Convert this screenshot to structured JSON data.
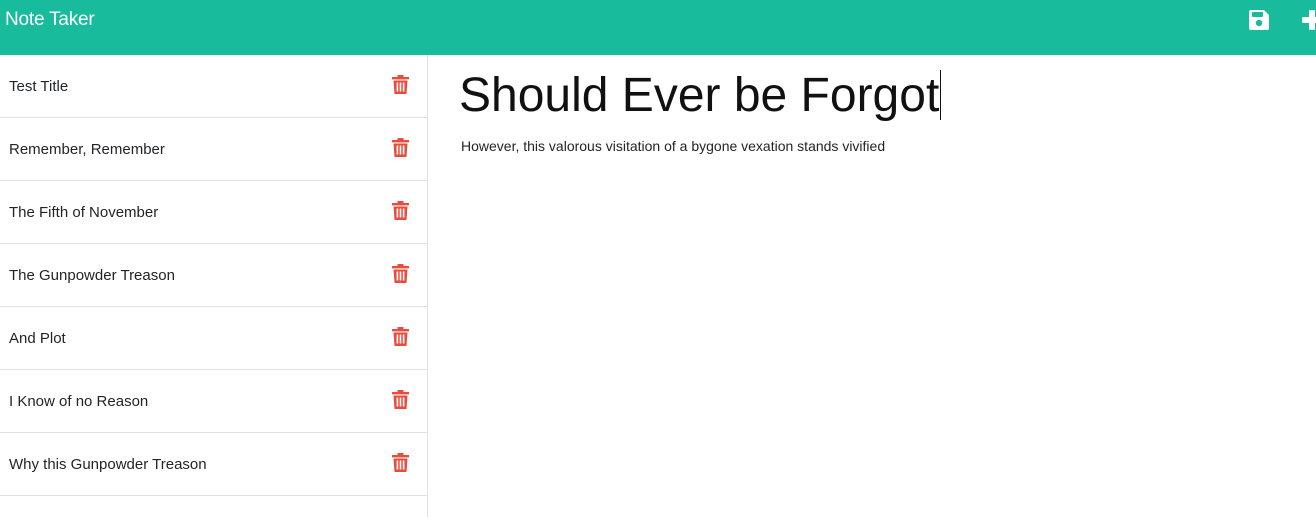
{
  "app": {
    "brand": "Note Taker",
    "accent_color": "#18bc9c",
    "delete_color": "#e74c3c"
  },
  "navbar": {
    "save_icon": "save-icon",
    "new_icon": "plus-icon"
  },
  "notes": [
    {
      "title": "Test Title"
    },
    {
      "title": "Remember, Remember"
    },
    {
      "title": "The Fifth of November"
    },
    {
      "title": "The Gunpowder Treason"
    },
    {
      "title": "And Plot"
    },
    {
      "title": "I Know of no Reason"
    },
    {
      "title": "Why this Gunpowder Treason"
    }
  ],
  "editor": {
    "title_value": "Should Ever be Forgot",
    "text_value": "However, this valorous visitation of a bygone vexation stands vivified"
  }
}
